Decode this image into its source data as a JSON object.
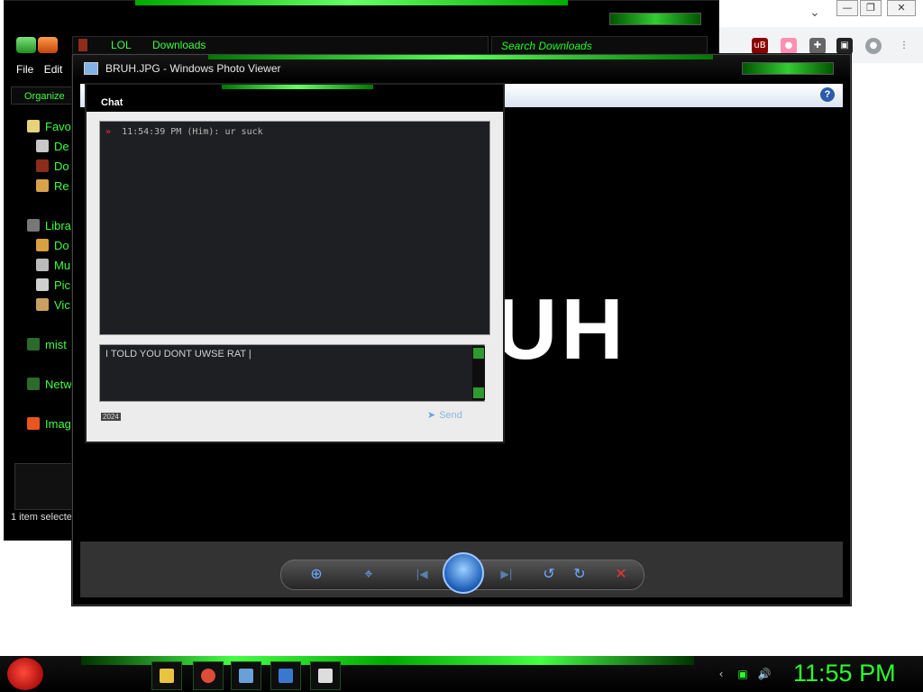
{
  "browser": {
    "controls": {
      "minimize": "—",
      "restore": "❐",
      "close": "✕"
    },
    "extensions": [
      "uB",
      "●",
      "✚",
      "▣",
      "●",
      "⋮"
    ],
    "dropdown": "⌄"
  },
  "explorer": {
    "address": {
      "path_1": "LOL",
      "path_2": "Downloads"
    },
    "search_placeholder": "Search Downloads",
    "menu": {
      "file": "File",
      "edit": "Edit"
    },
    "organize_label": "Organize",
    "sidebar": [
      {
        "label": "Favo",
        "icon": "star-icon",
        "color": "#e9d37a"
      },
      {
        "label": "De",
        "icon": "desktop-icon",
        "color": "#c8c8c8"
      },
      {
        "label": "Do",
        "icon": "downloads-icon",
        "color": "#8b2d1a"
      },
      {
        "label": "Re",
        "icon": "recent-icon",
        "color": "#d7a24a"
      },
      {
        "label": "Libra",
        "icon": "library-icon",
        "color": "#777"
      },
      {
        "label": "Do",
        "icon": "documents-icon",
        "color": "#d8a040"
      },
      {
        "label": "Mu",
        "icon": "music-icon",
        "color": "#bbb"
      },
      {
        "label": "Pic",
        "icon": "pictures-icon",
        "color": "#cfcfcf"
      },
      {
        "label": "Vic",
        "icon": "videos-icon",
        "color": "#caa060"
      },
      {
        "label": "mist",
        "icon": "homegroup-icon",
        "color": "#2c6a2c"
      },
      {
        "label": "Netw",
        "icon": "network-icon",
        "color": "#2c6a2c"
      },
      {
        "label": "Imag",
        "icon": "image-app-icon",
        "color": "#e8561e"
      }
    ],
    "status": "1 item selecte"
  },
  "viewer": {
    "title": "BRUH.JPG - Windows Photo Viewer",
    "image_text": "UH",
    "help": "?",
    "controls": {
      "zoom": "⊕",
      "fit": "⌖",
      "prev": "|◀",
      "next": "▶|",
      "rotate_ccw": "↺",
      "rotate_cw": "↻",
      "delete": "✕"
    }
  },
  "chat": {
    "title": "Chat",
    "log": [
      {
        "time": "11:54:39 PM",
        "sender": "(Him):",
        "message": "ur suck"
      }
    ],
    "input_value": "I TOLD YOU DONT UWSE RAT |",
    "tag": "2024",
    "send_label": "Send"
  },
  "taskbar": {
    "apps": [
      {
        "name": "explorer-task",
        "color": "#e8c440"
      },
      {
        "name": "chrome-task",
        "color": "#dd4b39"
      },
      {
        "name": "photo-viewer-task",
        "color": "#6aa0d8"
      },
      {
        "name": "notes-task",
        "color": "#3a78d0"
      },
      {
        "name": "chat-task",
        "color": "#ddd"
      }
    ],
    "tray": {
      "arrow": "‹",
      "network": "▣",
      "volume": "🔊"
    },
    "clock": "11:55 PM"
  }
}
